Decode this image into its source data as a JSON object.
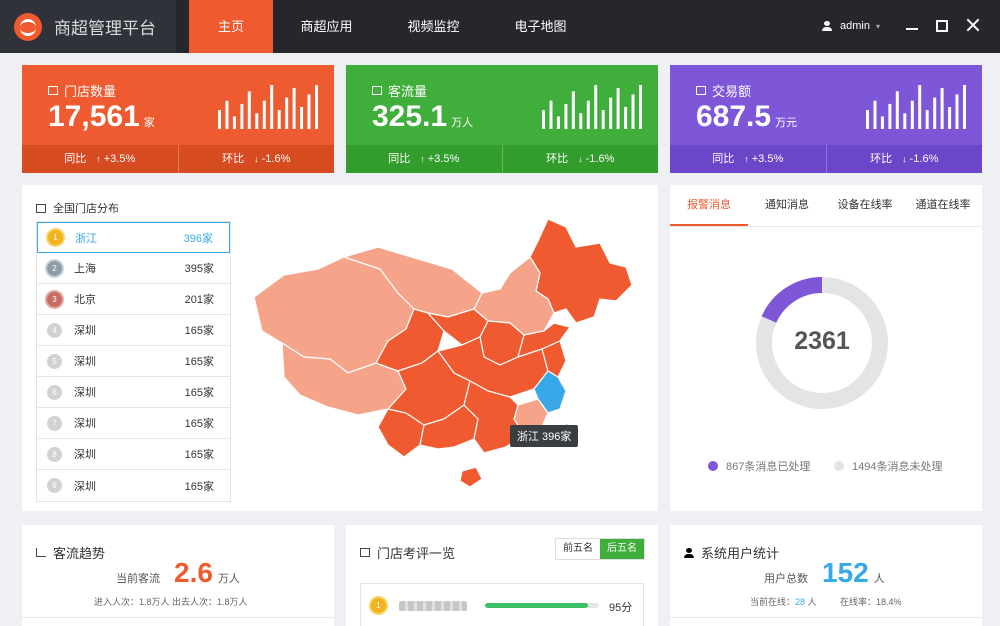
{
  "app": {
    "title": "商超管理平台"
  },
  "nav": [
    {
      "label": "主页",
      "active": true
    },
    {
      "label": "商超应用",
      "active": false
    },
    {
      "label": "视频监控",
      "active": false
    },
    {
      "label": "电子地图",
      "active": false
    }
  ],
  "user": {
    "name": "admin"
  },
  "kpis": [
    {
      "label": "门店数量",
      "value": "17,561",
      "unit": "家",
      "yoy_label": "同比",
      "yoy": "+3.5%",
      "mom_label": "环比",
      "mom": "-1.6%",
      "bars": [
        6,
        9,
        4,
        8,
        12,
        5,
        9,
        14,
        6,
        10,
        13,
        7,
        11,
        14
      ]
    },
    {
      "label": "客流量",
      "value": "325.1",
      "unit": "万人",
      "yoy_label": "同比",
      "yoy": "+3.5%",
      "mom_label": "环比",
      "mom": "-1.6%",
      "bars": [
        6,
        9,
        4,
        8,
        12,
        5,
        9,
        14,
        6,
        10,
        13,
        7,
        11,
        14
      ]
    },
    {
      "label": "交易额",
      "value": "687.5",
      "unit": "万元",
      "yoy_label": "同比",
      "yoy": "+3.5%",
      "mom_label": "环比",
      "mom": "-1.6%",
      "bars": [
        6,
        9,
        4,
        8,
        12,
        5,
        9,
        14,
        6,
        10,
        13,
        7,
        11,
        14
      ]
    }
  ],
  "colors": {
    "accent": "#ef5a2e",
    "green": "#3fae3a",
    "purple": "#7e57d8",
    "blue": "#38a8e8",
    "map_dark": "#f05a30",
    "map_light": "#f5a48a"
  },
  "store_distribution": {
    "title": "全国门店分布",
    "ranking": [
      {
        "rank": "1",
        "name": "浙江",
        "count": "396家",
        "medal": "gold",
        "active": true
      },
      {
        "rank": "2",
        "name": "上海",
        "count": "395家",
        "medal": "silver",
        "active": false
      },
      {
        "rank": "3",
        "name": "北京",
        "count": "201家",
        "medal": "bronze",
        "active": false
      },
      {
        "rank": "4",
        "name": "深圳",
        "count": "165家",
        "medal": "plain",
        "active": false
      },
      {
        "rank": "5",
        "name": "深圳",
        "count": "165家",
        "medal": "plain",
        "active": false
      },
      {
        "rank": "6",
        "name": "深圳",
        "count": "165家",
        "medal": "plain",
        "active": false
      },
      {
        "rank": "7",
        "name": "深圳",
        "count": "165家",
        "medal": "plain",
        "active": false
      },
      {
        "rank": "8",
        "name": "深圳",
        "count": "165家",
        "medal": "plain",
        "active": false
      },
      {
        "rank": "9",
        "name": "深圳",
        "count": "165家",
        "medal": "plain",
        "active": false
      }
    ],
    "tooltip": "浙江  396家"
  },
  "alarm": {
    "tabs": [
      {
        "label": "报警消息",
        "active": true
      },
      {
        "label": "通知消息",
        "active": false
      },
      {
        "label": "设备在线率",
        "active": false
      },
      {
        "label": "通道在线率",
        "active": false
      }
    ],
    "total": "2361",
    "processed": 867,
    "unprocessed": 1494,
    "processed_label": "867条消息已处理",
    "unprocessed_label": "1494条消息未处理"
  },
  "traffic_trend": {
    "title": "客流趋势",
    "current_label": "当前客流",
    "current_value": "2.6",
    "current_unit": "万人",
    "sub": "进入人次：1.8万人    出去人次：1.8万人"
  },
  "store_review": {
    "title": "门店考评一览",
    "toggle": [
      {
        "label": "前五名",
        "active": false
      },
      {
        "label": "后五名",
        "active": true
      }
    ],
    "top": {
      "score": 95,
      "score_label": "95分",
      "progress": 0.9
    }
  },
  "user_stats": {
    "title": "系统用户统计",
    "total_label": "用户总数",
    "total_value": "152",
    "total_unit": "人",
    "online_label": "当前在线：",
    "online_value": "28",
    "online_unit": " 人",
    "rate": "在线率：18.4%"
  }
}
